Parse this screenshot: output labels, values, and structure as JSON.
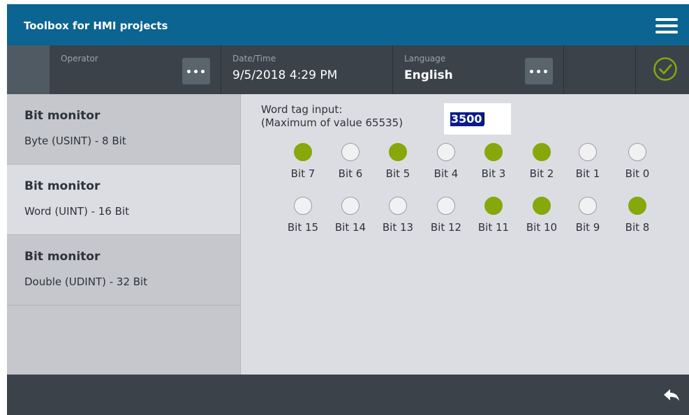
{
  "app": {
    "title": "Toolbox for HMI projects"
  },
  "infobar": {
    "operator_label": "Operator",
    "datetime_label": "Date/Time",
    "datetime_value": "9/5/2018 4:29 PM",
    "language_label": "Language",
    "language_value": "English"
  },
  "sidebar": {
    "items": [
      {
        "title": "Bit monitor",
        "subtitle": "Byte (USINT)  - 8 Bit",
        "active": false
      },
      {
        "title": "Bit monitor",
        "subtitle": "Word (UINT) - 16 Bit",
        "active": true
      },
      {
        "title": "Bit monitor",
        "subtitle": "Double (UDINT) - 32 Bit",
        "active": false
      }
    ]
  },
  "word_input": {
    "label_line1": "Word tag input:",
    "label_line2": "(Maximum of value 65535)",
    "value": "3500"
  },
  "bit_rows": [
    {
      "bits": [
        {
          "label": "Bit 7",
          "on": true
        },
        {
          "label": "Bit 6",
          "on": false
        },
        {
          "label": "Bit 5",
          "on": true
        },
        {
          "label": "Bit 4",
          "on": false
        },
        {
          "label": "Bit 3",
          "on": true
        },
        {
          "label": "Bit 2",
          "on": true
        },
        {
          "label": "Bit 1",
          "on": false
        },
        {
          "label": "Bit 0",
          "on": false
        }
      ]
    },
    {
      "bits": [
        {
          "label": "Bit 15",
          "on": false
        },
        {
          "label": "Bit 14",
          "on": false
        },
        {
          "label": "Bit 13",
          "on": false
        },
        {
          "label": "Bit 12",
          "on": false
        },
        {
          "label": "Bit 11",
          "on": true
        },
        {
          "label": "Bit 10",
          "on": true
        },
        {
          "label": "Bit 9",
          "on": false
        },
        {
          "label": "Bit 8",
          "on": true
        }
      ]
    }
  ],
  "icons": {
    "menu": "hamburger-menu-icon",
    "more": "more-dots-icon",
    "status": "check-circle-icon",
    "back": "reply-arrow-icon"
  },
  "colors": {
    "header": "#0b6492",
    "infobar": "#3b424a",
    "bit_on": "#86a80a",
    "bit_off": "#f1f1f3",
    "status_ok": "#86a80a"
  }
}
